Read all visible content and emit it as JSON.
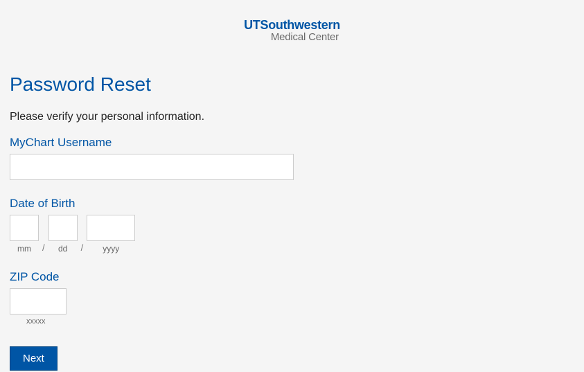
{
  "header": {
    "logo_top": "UTSouthwestern",
    "logo_sub": "Medical Center"
  },
  "page": {
    "title": "Password Reset",
    "instruction": "Please verify your personal information."
  },
  "fields": {
    "username": {
      "label": "MyChart Username",
      "value": ""
    },
    "dob": {
      "label": "Date of Birth",
      "mm_hint": "mm",
      "dd_hint": "dd",
      "yyyy_hint": "yyyy",
      "sep": "/"
    },
    "zip": {
      "label": "ZIP Code",
      "hint": "xxxxx",
      "value": ""
    }
  },
  "buttons": {
    "next": "Next"
  }
}
